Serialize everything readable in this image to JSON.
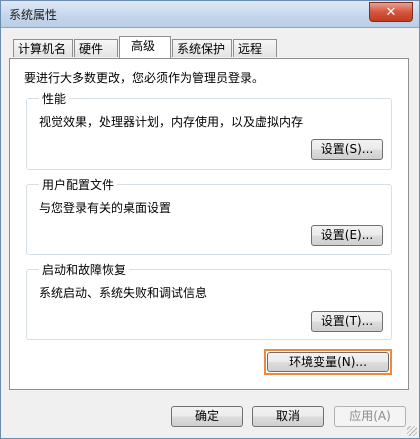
{
  "window": {
    "title": "系统属性",
    "close_symbol": "✕"
  },
  "tabs": [
    {
      "label": "计算机名"
    },
    {
      "label": "硬件"
    },
    {
      "label": "高级",
      "active": true
    },
    {
      "label": "系统保护"
    },
    {
      "label": "远程"
    }
  ],
  "admin_note": "要进行大多数更改，您必须作为管理员登录。",
  "groups": {
    "performance": {
      "title": "性能",
      "description": "视觉效果，处理器计划，内存使用，以及虚拟内存",
      "button": "设置(S)..."
    },
    "user_profiles": {
      "title": "用户配置文件",
      "description": "与您登录有关的桌面设置",
      "button": "设置(E)..."
    },
    "startup_recovery": {
      "title": "启动和故障恢复",
      "description": "系统启动、系统失败和调试信息",
      "button": "设置(T)..."
    }
  },
  "env_button": "环境变量(N)...",
  "footer": {
    "ok": "确定",
    "cancel": "取消",
    "apply": "应用(A)"
  },
  "colors": {
    "highlight_border": "#f0883a",
    "close_button": "#c23a22"
  }
}
